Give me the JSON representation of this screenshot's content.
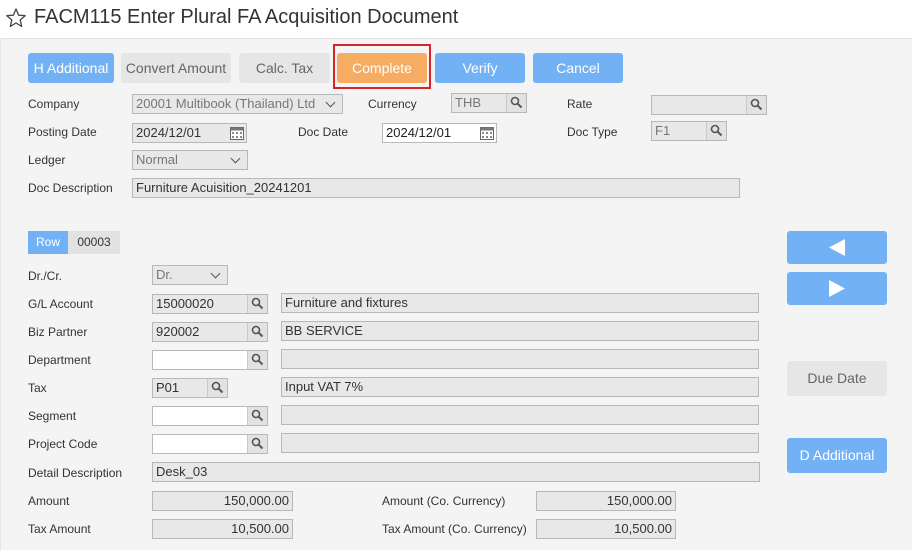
{
  "window": {
    "title": "FACM115 Enter Plural FA Acquisition Document"
  },
  "toolbar": {
    "h_additional": "H Additional",
    "convert_amount": "Convert Amount",
    "calc_tax": "Calc. Tax",
    "complete": "Complete",
    "verify": "Verify",
    "cancel": "Cancel"
  },
  "header": {
    "company_label": "Company",
    "company_value": "20001 Multibook (Thailand) Ltd",
    "currency_label": "Currency",
    "currency_value": "THB",
    "rate_label": "Rate",
    "rate_value": "",
    "posting_date_label": "Posting Date",
    "posting_date_value": "2024/12/01",
    "doc_date_label": "Doc Date",
    "doc_date_value": "2024/12/01",
    "doc_type_label": "Doc Type",
    "doc_type_value": "F1",
    "ledger_label": "Ledger",
    "ledger_value": "Normal",
    "doc_desc_label": "Doc Description",
    "doc_desc_value": "Furniture Acuisition_20241201"
  },
  "detail": {
    "row_label": "Row",
    "row_number": "00003",
    "drcr_label": "Dr./Cr.",
    "drcr_value": "Dr.",
    "gl_label": "G/L Account",
    "gl_code": "15000020",
    "gl_name": "Furniture and fixtures",
    "biz_label": "Biz Partner",
    "biz_code": "920002",
    "biz_name": "BB SERVICE",
    "dept_label": "Department",
    "dept_code": "",
    "dept_name": "",
    "tax_label": "Tax",
    "tax_code": "P01",
    "tax_name": "Input VAT 7%",
    "segment_label": "Segment",
    "segment_code": "",
    "segment_name": "",
    "project_label": "Project Code",
    "project_code": "",
    "project_name": "",
    "detail_desc_label": "Detail Description",
    "detail_desc_value": "Desk_03",
    "amount_label": "Amount",
    "amount_value": "150,000.00",
    "amount_co_label": "Amount (Co. Currency)",
    "amount_co_value": "150,000.00",
    "tax_amount_label": "Tax Amount",
    "tax_amount_value": "10,500.00",
    "tax_amount_co_label": "Tax Amount (Co. Currency)",
    "tax_amount_co_value": "10,500.00"
  },
  "side": {
    "prev_icon": "arrow-left-icon",
    "next_icon": "arrow-right-icon",
    "due_date": "Due Date",
    "d_additional": "D Additional"
  },
  "icons": {
    "favorite": "star-outline-icon",
    "search": "magnifier-icon",
    "calendar": "calendar-icon"
  },
  "colors": {
    "primary_button": "#72b2f4",
    "complete_button": "#f6ac62",
    "highlight_border": "#d8232a",
    "disabled_button": "#e6e6e6"
  }
}
